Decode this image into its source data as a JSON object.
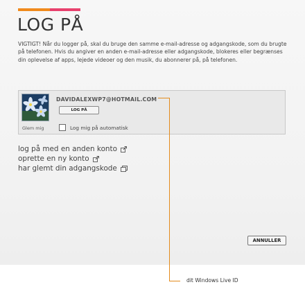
{
  "title": "LOG PÅ",
  "notice": "VIGTIGT! Når du logger på, skal du bruge den samme e-mail-adresse og adgangskode, som du brugte på telefonen. Hvis du angiver en anden e-mail-adresse eller adgangskode, blokeres eller begrænses din oplevelse af apps, lejede videoer og den musik, du abonnerer på, på telefonen.",
  "account": {
    "email": "DAVIDALEXWP7@HOTMAIL.COM",
    "login_button": "LOG PÅ",
    "forget_label": "Glem mig",
    "auto_login_label": "Log mig på automatisk",
    "auto_login_checked": false
  },
  "links": [
    {
      "label": "log på med en anden konto",
      "icon": "external-link-icon"
    },
    {
      "label": "oprette en ny konto",
      "icon": "external-link-icon"
    },
    {
      "label": "har glemt din adgangskode",
      "icon": "popup-window-icon"
    }
  ],
  "cancel_button": "ANNULLER",
  "callout": {
    "label": "dit Windows Live ID"
  },
  "colors": {
    "accent_orange": "#f08a1c",
    "accent_pink": "#e8416d",
    "callout_line": "#e38b1c"
  }
}
